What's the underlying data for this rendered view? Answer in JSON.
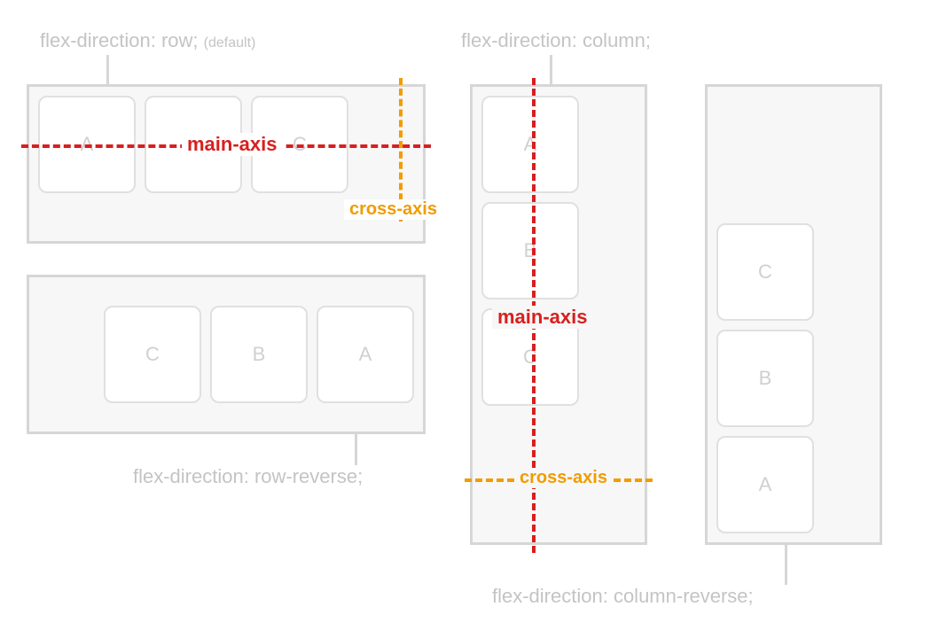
{
  "captions": {
    "row": "flex-direction: row;",
    "rowDefault": "(default)",
    "rowrev": "flex-direction: row-reverse;",
    "col": "flex-direction: column;",
    "colrev": "flex-direction: column-reverse;"
  },
  "items": {
    "a": "A",
    "b": "B",
    "c": "C"
  },
  "axes": {
    "main": "main-axis",
    "cross": "cross-axis"
  }
}
